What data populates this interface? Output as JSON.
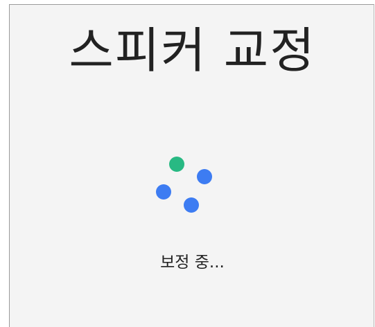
{
  "dialog": {
    "title": "스피커 교정",
    "status_text": "보정 중..."
  },
  "spinner": {
    "dots": [
      {
        "color": "#28b983"
      },
      {
        "color": "#3d7cf2"
      },
      {
        "color": "#3d7cf2"
      },
      {
        "color": "#3d7cf2"
      }
    ]
  },
  "colors": {
    "background": "#f4f4f4",
    "text": "#222222",
    "accent_green": "#28b983",
    "accent_blue": "#3d7cf2"
  }
}
